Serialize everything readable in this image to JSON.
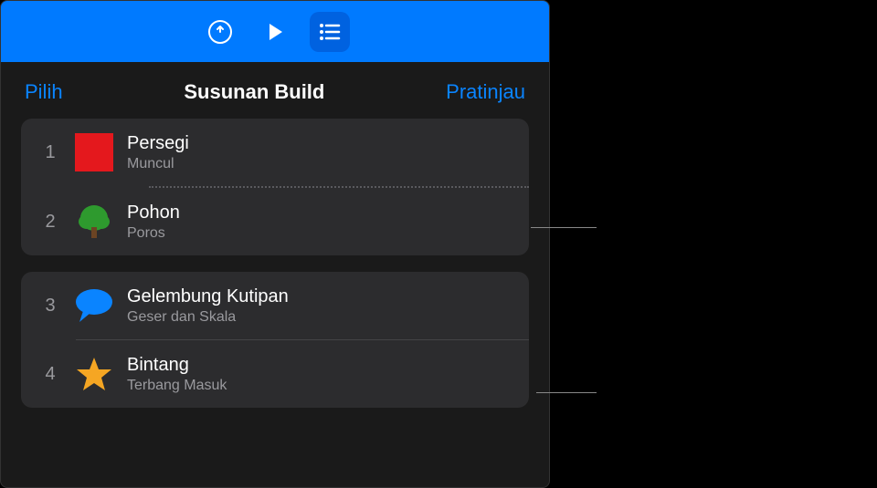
{
  "toolbar": {
    "undo": "undo",
    "play": "play",
    "list": "list"
  },
  "subheader": {
    "left": "Pilih",
    "title": "Susunan Build",
    "right": "Pratinjau"
  },
  "groups": [
    {
      "rows": [
        {
          "num": "1",
          "title": "Persegi",
          "sub": "Muncul",
          "icon": "square"
        },
        {
          "num": "2",
          "title": "Pohon",
          "sub": "Poros",
          "icon": "tree"
        }
      ],
      "divider": "dotted"
    },
    {
      "rows": [
        {
          "num": "3",
          "title": "Gelembung Kutipan",
          "sub": "Geser dan Skala",
          "icon": "bubble"
        },
        {
          "num": "4",
          "title": "Bintang",
          "sub": "Terbang Masuk",
          "icon": "star"
        }
      ],
      "divider": "solid"
    }
  ]
}
